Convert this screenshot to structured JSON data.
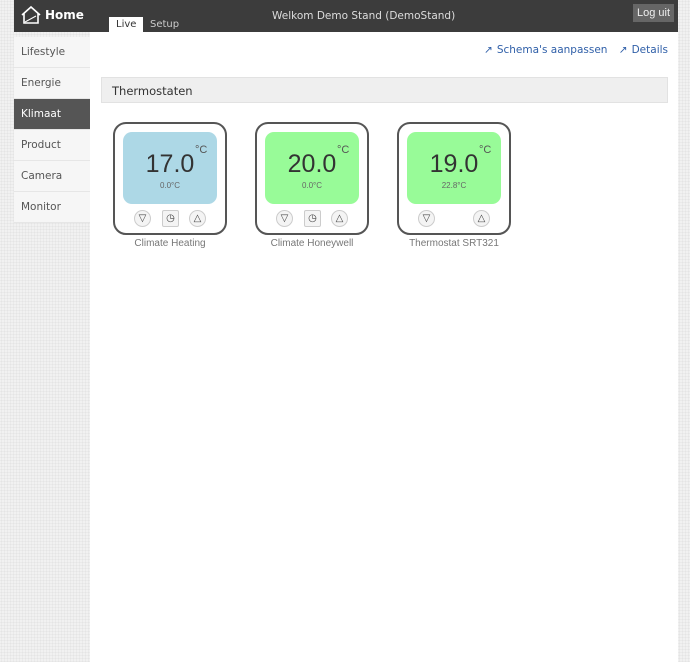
{
  "header": {
    "home": "Home",
    "tabs": [
      "Live",
      "Setup"
    ],
    "welcome": "Welkom Demo Stand (DemoStand)",
    "logout": "Log uit"
  },
  "sidebar": {
    "items": [
      "Lifestyle",
      "Energie",
      "Klimaat",
      "Product",
      "Camera",
      "Monitor"
    ],
    "active": "Klimaat"
  },
  "links": {
    "schema": "Schema's aanpassen",
    "details": "Details"
  },
  "section": {
    "title": "Thermostaten"
  },
  "thermostats": [
    {
      "name": "Climate Heating",
      "setpoint": "17.0",
      "unit": "°C",
      "current": "0.0°C",
      "color": "#add8e6",
      "clock": true
    },
    {
      "name": "Climate Honeywell",
      "setpoint": "20.0",
      "unit": "°C",
      "current": "0.0°C",
      "color": "#98fb98",
      "clock": true
    },
    {
      "name": "Thermostat SRT321",
      "setpoint": "19.0",
      "unit": "°C",
      "current": "22.8°C",
      "color": "#98fb98",
      "clock": false
    }
  ]
}
